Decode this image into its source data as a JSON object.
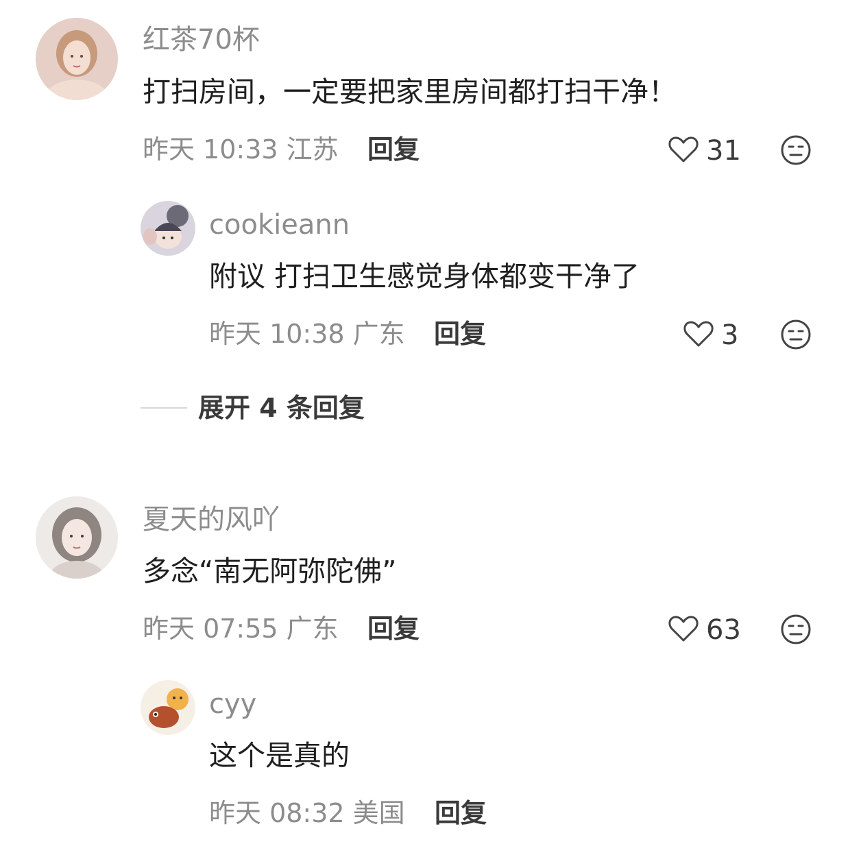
{
  "comments": [
    {
      "username": "红茶70杯",
      "text": "打扫房间，一定要把家里房间都打扫干净！",
      "meta": "昨天 10:33 江苏",
      "reply_label": "回复",
      "likes": "31",
      "icons": {
        "like": "heart-outline-icon",
        "dislike": "meh-face-icon"
      },
      "replies": [
        {
          "username": "cookieann",
          "text": "附议 打扫卫生感觉身体都变干净了",
          "meta": "昨天 10:38 广东",
          "reply_label": "回复",
          "likes": "3"
        }
      ],
      "expand_label": "展开 4 条回复"
    },
    {
      "username": "夏天的风吖",
      "text": "多念“南无阿弥陀佛”",
      "meta": "昨天 07:55 广东",
      "reply_label": "回复",
      "likes": "63",
      "replies": [
        {
          "username": "cyy",
          "text": "这个是真的",
          "meta": "昨天 08:32 美国",
          "reply_label": "回复"
        }
      ]
    }
  ],
  "colors": {
    "meta_gray": "#8c8c8c",
    "text_dark": "#1f1f1f",
    "background": "#ffffff"
  }
}
